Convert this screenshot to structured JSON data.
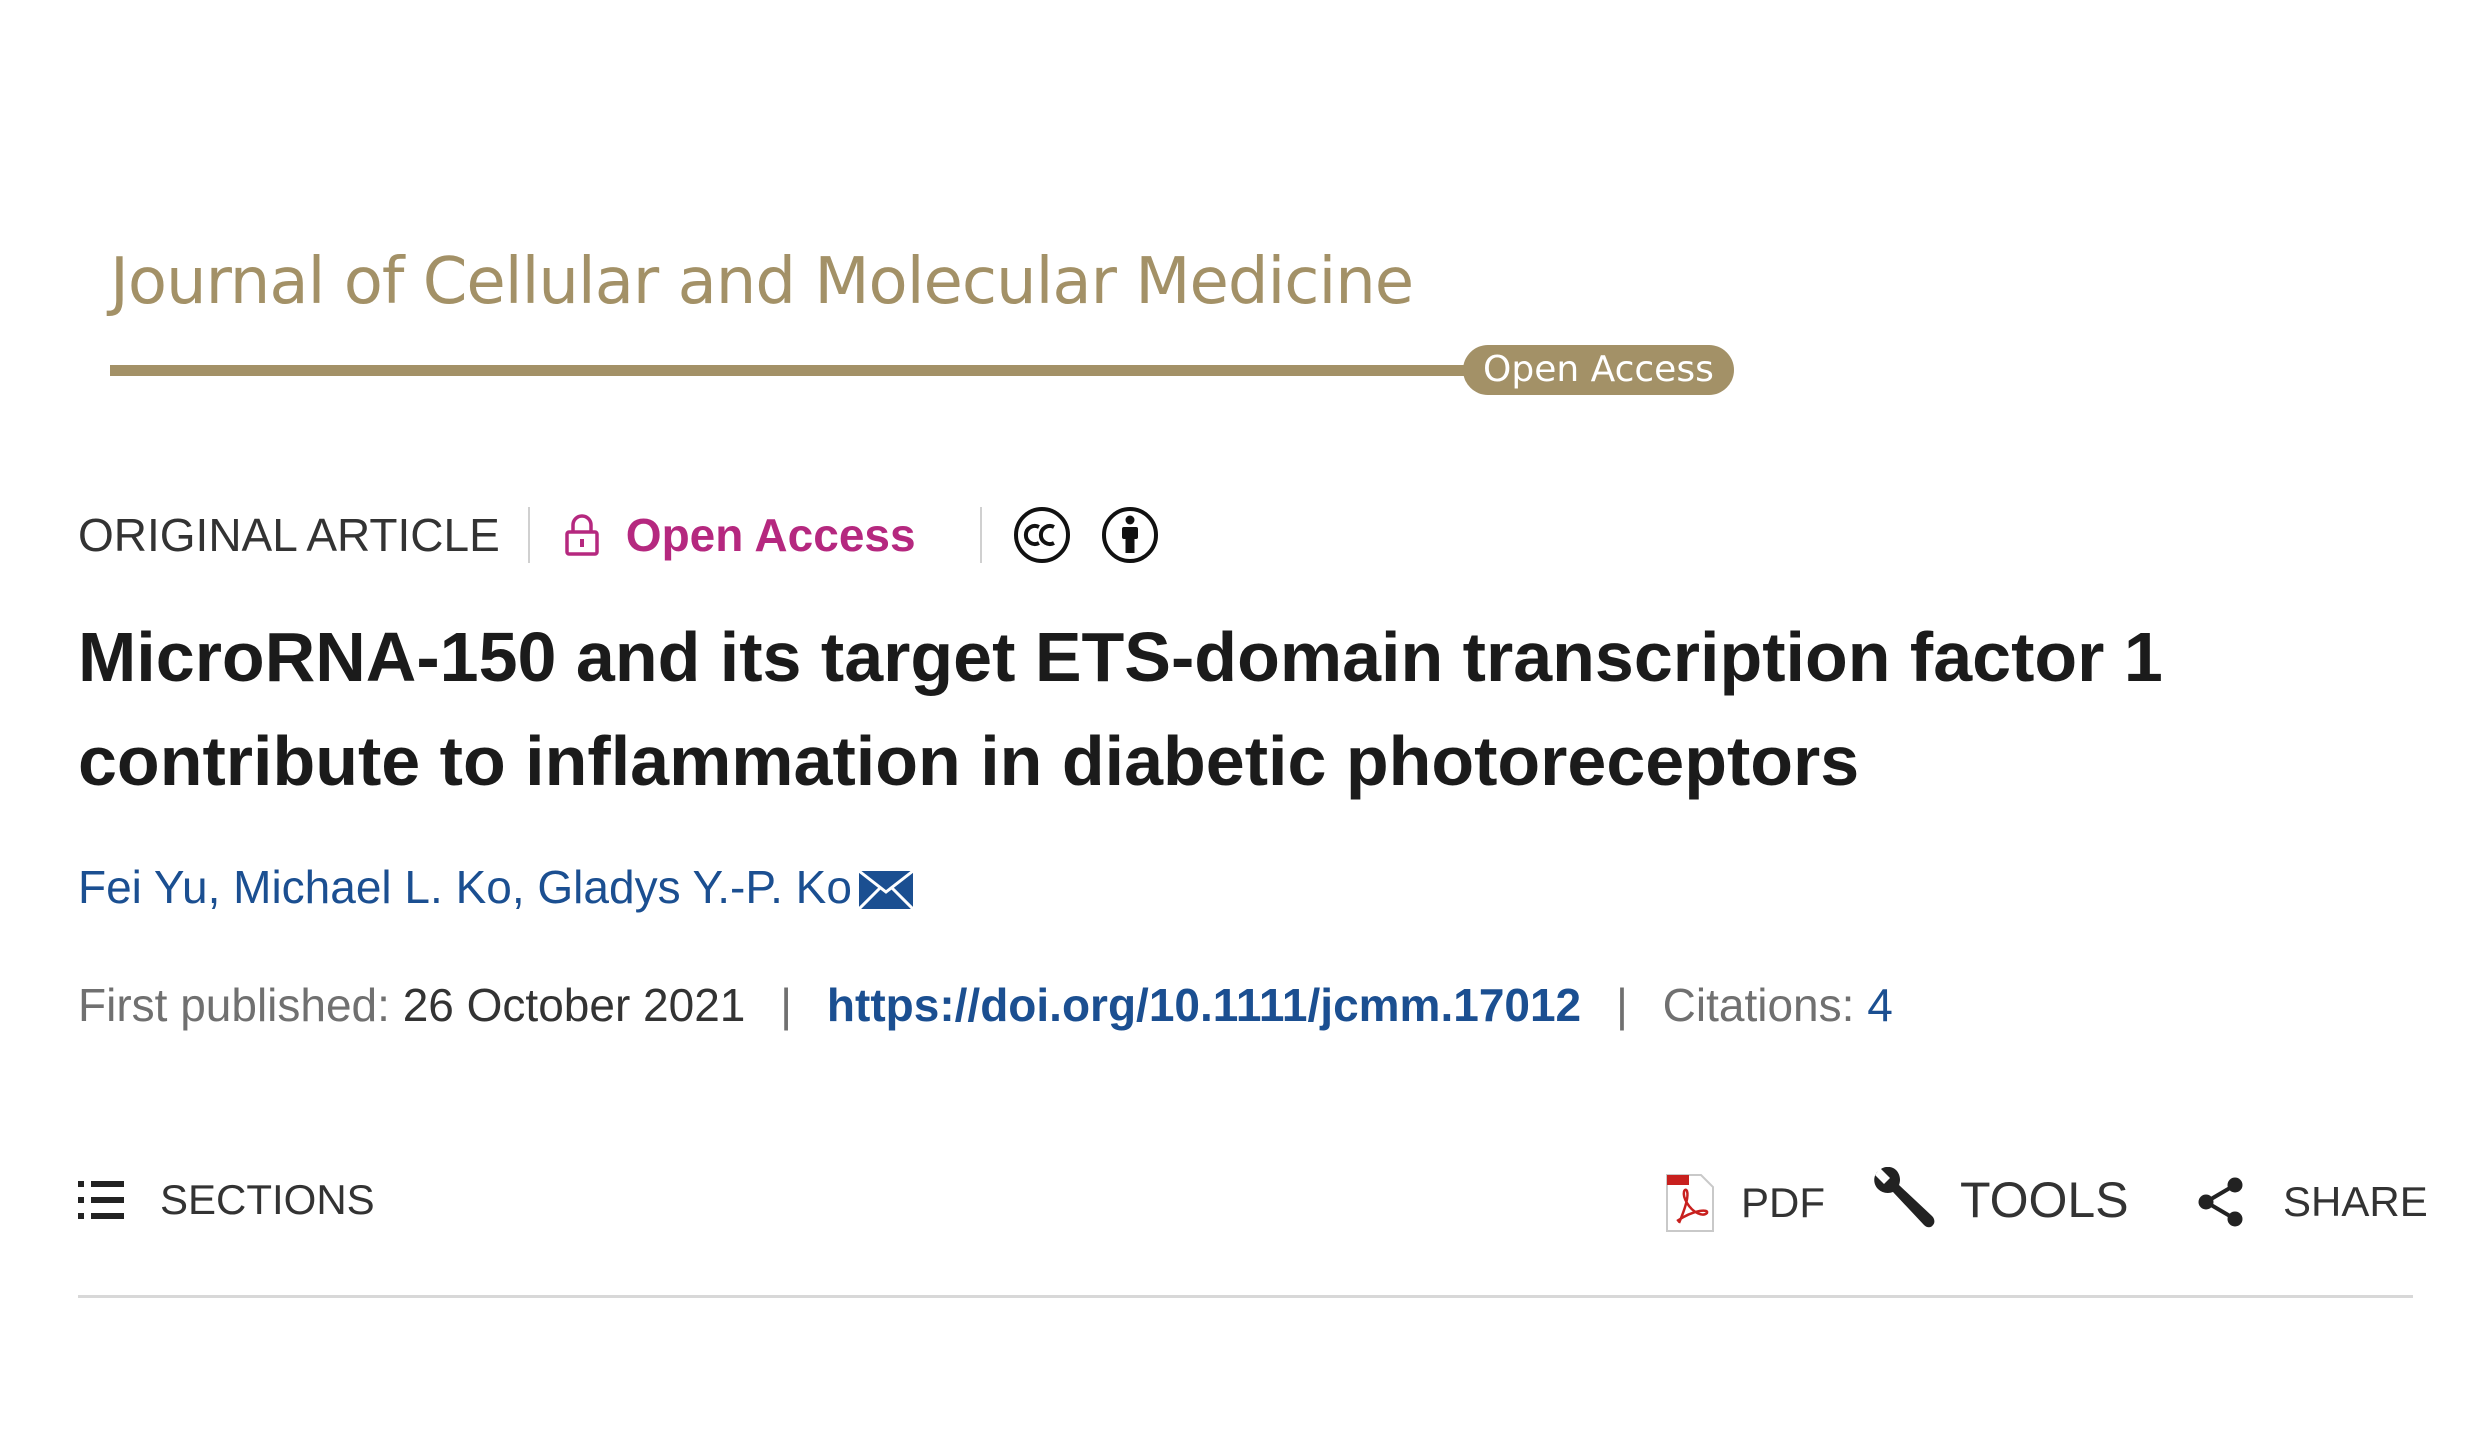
{
  "journal": {
    "name": "Journal of Cellular and Molecular Medicine",
    "badge": "Open Access",
    "color": "#a39167"
  },
  "meta": {
    "article_type": "ORIGINAL ARTICLE",
    "access_label": "Open Access",
    "access_color": "#b5287f",
    "license_icons": [
      "creative-commons-icon",
      "attribution-icon"
    ]
  },
  "article": {
    "title": "MicroRNA-150 and its target ETS-domain transcription factor 1 contribute to inflammation in diabetic photoreceptors",
    "authors": [
      "Fei Yu",
      "Michael L. Ko",
      "Gladys Y.-P. Ko"
    ],
    "corresponding_icon": "mail-icon"
  },
  "publication": {
    "first_published_label": "First published:",
    "first_published_date": "26 October 2021",
    "separator": "|",
    "doi": "https://doi.org/10.1111/jcmm.17012",
    "citations_label": "Citations:",
    "citations_count": "4",
    "link_color": "#1b4f91"
  },
  "toolbar": {
    "sections_label": "SECTIONS",
    "pdf_label": "PDF",
    "tools_label": "TOOLS",
    "share_label": "SHARE"
  }
}
